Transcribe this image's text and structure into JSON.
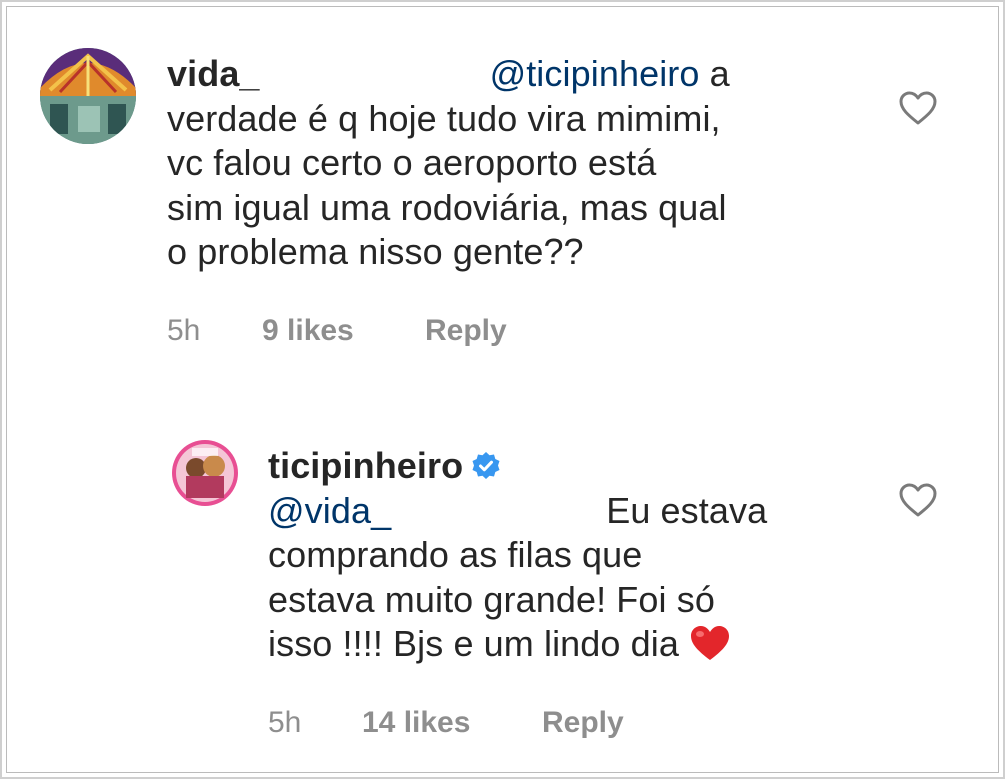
{
  "comments": [
    {
      "username": "vida_",
      "mention": "@ticipinheiro",
      "line1_tail": "a",
      "lines": [
        "verdade é q hoje tudo vira mimimi,",
        "vc falou certo o aeroporto está",
        "sim igual uma rodoviária, mas qual",
        "o problema nisso gente??"
      ],
      "time": "5h",
      "likes": "9 likes",
      "reply": "Reply"
    },
    {
      "username": "ticipinheiro",
      "verified": true,
      "mention": "@vida_",
      "line1_tail": "Eu estava",
      "lines": [
        "comprando as filas que",
        "estava muito grande! Foi só",
        "isso !!!! Bjs e um lindo dia"
      ],
      "emoji": "red-heart",
      "time": "5h",
      "likes": "14 likes",
      "reply": "Reply"
    }
  ],
  "colors": {
    "text": "#262626",
    "mention": "#003569",
    "meta": "#8e8e8e",
    "verified": "#3897f0",
    "heart_emoji": "#e3262b"
  }
}
